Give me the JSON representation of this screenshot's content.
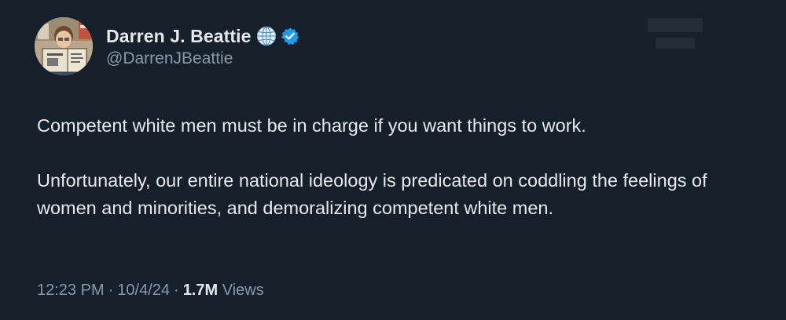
{
  "author": {
    "display_name": "Darren J. Beattie",
    "handle": "@DarrenJBeattie",
    "badges": [
      "globe-icon",
      "verified-badge-icon"
    ],
    "verified_color": "#1d9bf0"
  },
  "tweet": {
    "paragraphs": [
      "Competent white men must be in charge if you want things to work.",
      "Unfortunately, our entire national ideology is predicated on coddling the feelings of women and minorities, and demoralizing competent white men."
    ],
    "time": "12:23 PM",
    "date": "10/4/24",
    "views_count": "1.7M",
    "views_label": "Views",
    "separator": "·"
  },
  "theme": {
    "background": "#15202b",
    "text_primary": "#e7e9ea",
    "text_secondary": "#8b98a5"
  }
}
